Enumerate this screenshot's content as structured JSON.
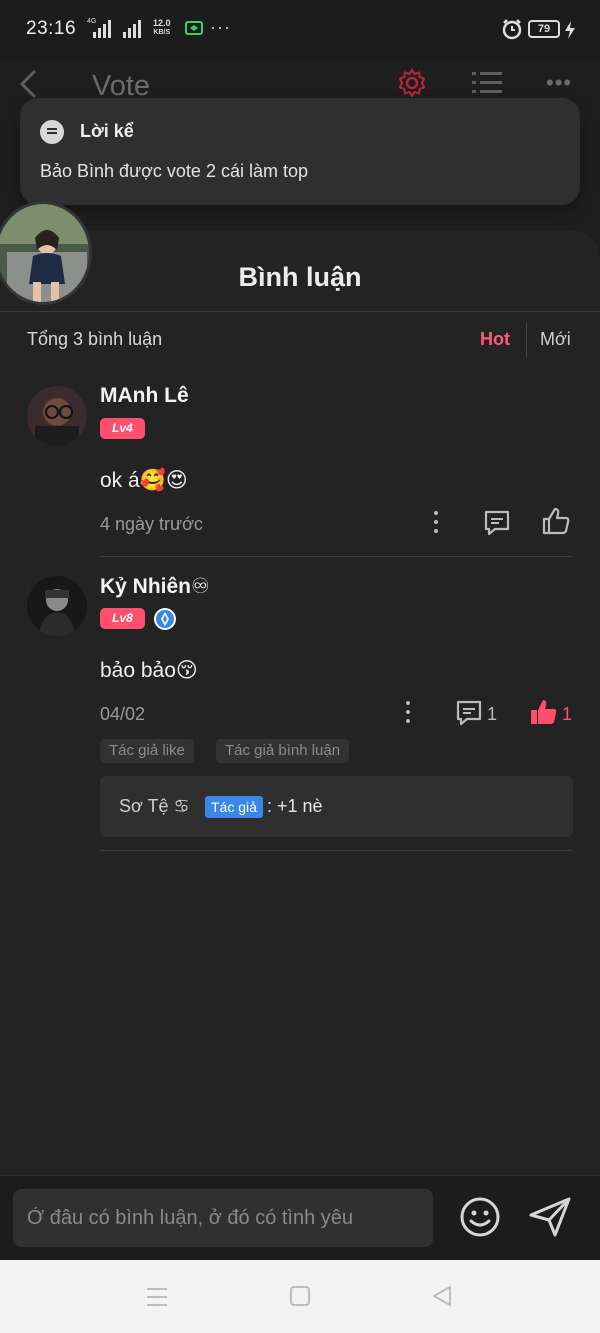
{
  "status_bar": {
    "time": "23:16",
    "network_label": "4G",
    "speed_value": "12.0",
    "speed_unit": "KB/S",
    "more": "···",
    "battery": "79"
  },
  "header": {
    "title": "Vote"
  },
  "toast": {
    "title": "Lời kể",
    "body": "Bảo Bình được vote 2 cái làm top"
  },
  "comments_panel": {
    "title": "Bình luận",
    "count_label": "Tổng 3 bình luận",
    "sort_hot": "Hot",
    "sort_new": "Mới"
  },
  "comments": [
    {
      "name": "MAnh Lê",
      "level": "Lv4",
      "text": "ok á🥰😍",
      "time": "4 ngày trước"
    },
    {
      "name": "Kỷ Nhiên♾",
      "level": "Lv8",
      "text": "bảo bảo😚",
      "time": "04/02",
      "reply_count": "1",
      "like_count": "1",
      "tags": [
        "Tác giả like",
        "Tác giả bình luận"
      ],
      "reply": {
        "author": "Sơ Tệ ♋",
        "badge": "Tác giả",
        "text": ": +1 nè"
      }
    }
  ],
  "composer": {
    "placeholder": "Ở đâu có bình luận, ở đó có tình yêu"
  },
  "colors": {
    "accent": "#ff4f6f",
    "hot": "#ff5c7c",
    "author_badge": "#3a88e6",
    "background": "#232323"
  }
}
